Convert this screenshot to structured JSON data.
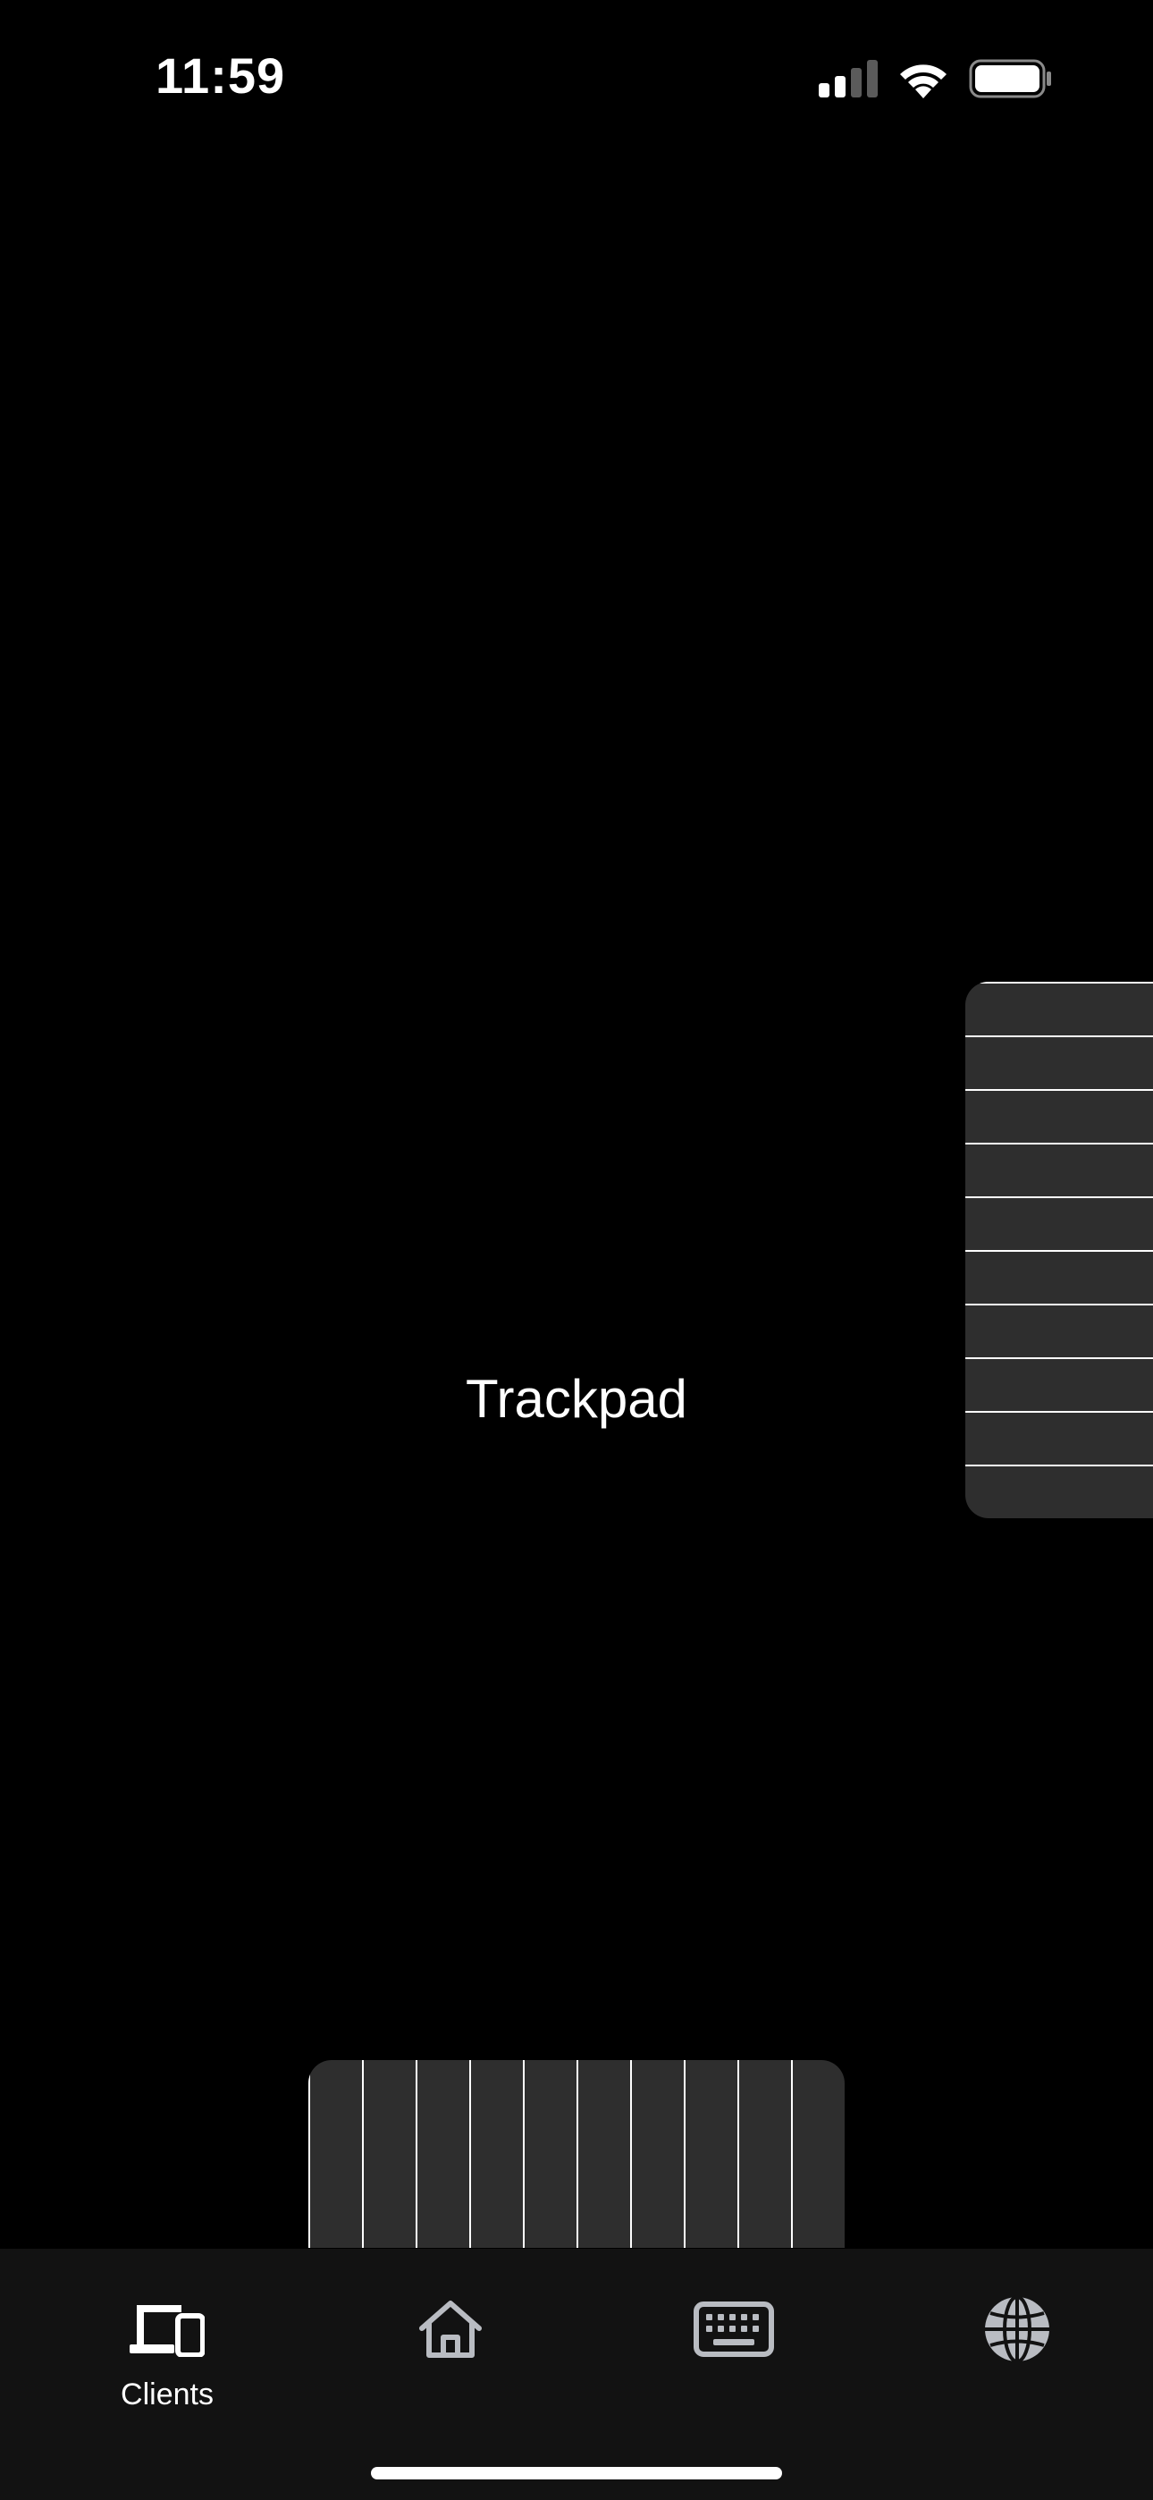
{
  "status_bar": {
    "time": "11:59"
  },
  "trackpad": {
    "label": "Trackpad"
  },
  "tab_bar": {
    "tabs": [
      {
        "label": "Clients",
        "icon": "devices-icon",
        "selected": true
      },
      {
        "label": "",
        "icon": "home-icon",
        "selected": false
      },
      {
        "label": "",
        "icon": "keyboard-icon",
        "selected": false
      },
      {
        "label": "",
        "icon": "globe-icon",
        "selected": false
      }
    ]
  },
  "colors": {
    "background": "#000000",
    "strip": "#2e2e2e",
    "tab_bar": "#121212",
    "inactive_icon": "#b9bcc2",
    "active_icon": "#ffffff"
  }
}
